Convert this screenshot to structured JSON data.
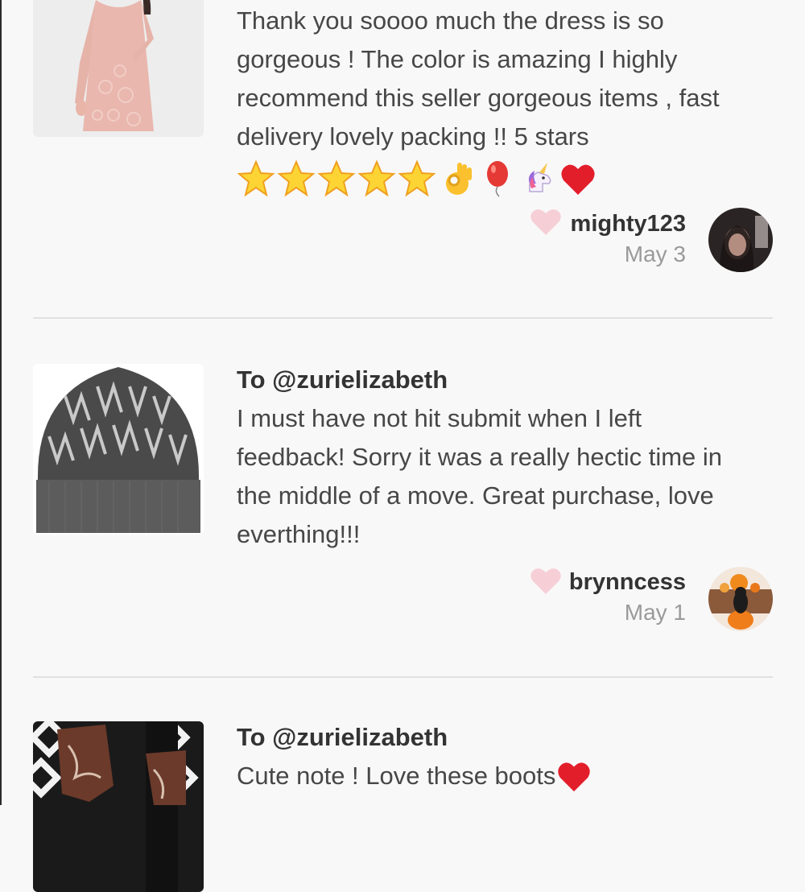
{
  "reviews": [
    {
      "to": "",
      "text": "Thank you soooo much the dress is so gorgeous ! The color is amazing I highly recommend this seller gorgeous items , fast delivery lovely packing !! 5 stars",
      "emojis": [
        "star-icon",
        "star-icon",
        "star-icon",
        "star-icon",
        "star-icon",
        "ok-hand-icon",
        "balloon-icon",
        "unicorn-icon",
        "red-heart-icon"
      ],
      "username": "mighty123",
      "date": "May 3",
      "thumb_icon": "pink-lace-dress"
    },
    {
      "to": "To @zurielizabeth",
      "text": "I must have not hit submit when I left feedback! Sorry it was a really hectic time in the middle of a move. Great purchase, love everthing!!!",
      "username": "brynncess",
      "date": "May 1",
      "thumb_icon": "monogram-beanie"
    },
    {
      "to": "To @zurielizabeth",
      "text": "Cute note ! Love these boots",
      "thumb_icon": "cowboy-boots"
    }
  ],
  "colors": {
    "heart": "#f6cfd6",
    "divider": "#e1dfe0",
    "background": "#f9f8f9"
  }
}
